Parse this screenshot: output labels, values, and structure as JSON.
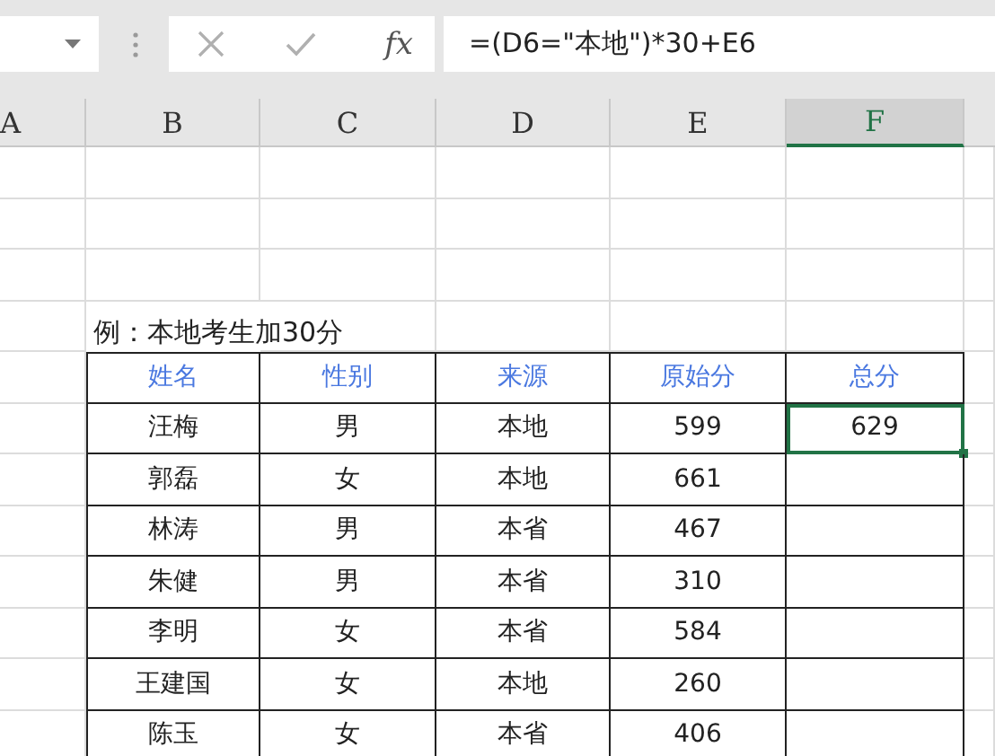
{
  "formula_bar": {
    "function_label": "fx",
    "formula": "=(D6=\"本地\")*30+E6"
  },
  "columns": [
    {
      "label": "A",
      "selected": false
    },
    {
      "label": "B",
      "selected": false
    },
    {
      "label": "C",
      "selected": false
    },
    {
      "label": "D",
      "selected": false
    },
    {
      "label": "E",
      "selected": false
    },
    {
      "label": "F",
      "selected": true
    }
  ],
  "caption": "例：本地考生加30分",
  "table": {
    "headers": [
      "姓名",
      "性别",
      "来源",
      "原始分",
      "总分"
    ],
    "rows": [
      {
        "cells": [
          "汪梅",
          "男",
          "本地",
          "599",
          "629"
        ],
        "selected": true
      },
      {
        "cells": [
          "郭磊",
          "女",
          "本地",
          "661"
        ],
        "selected": false
      },
      {
        "cells": [
          "林涛",
          "男",
          "本省",
          "467"
        ],
        "selected": false
      },
      {
        "cells": [
          "朱健",
          "男",
          "本省",
          "310"
        ],
        "selected": false
      },
      {
        "cells": [
          "李明",
          "女",
          "本省",
          "584"
        ],
        "selected": false
      },
      {
        "cells": [
          "王建国",
          "女",
          "本地",
          "260"
        ],
        "selected": false
      },
      {
        "cells": [
          "陈玉",
          "女",
          "本省",
          "406"
        ],
        "selected": false
      }
    ]
  }
}
